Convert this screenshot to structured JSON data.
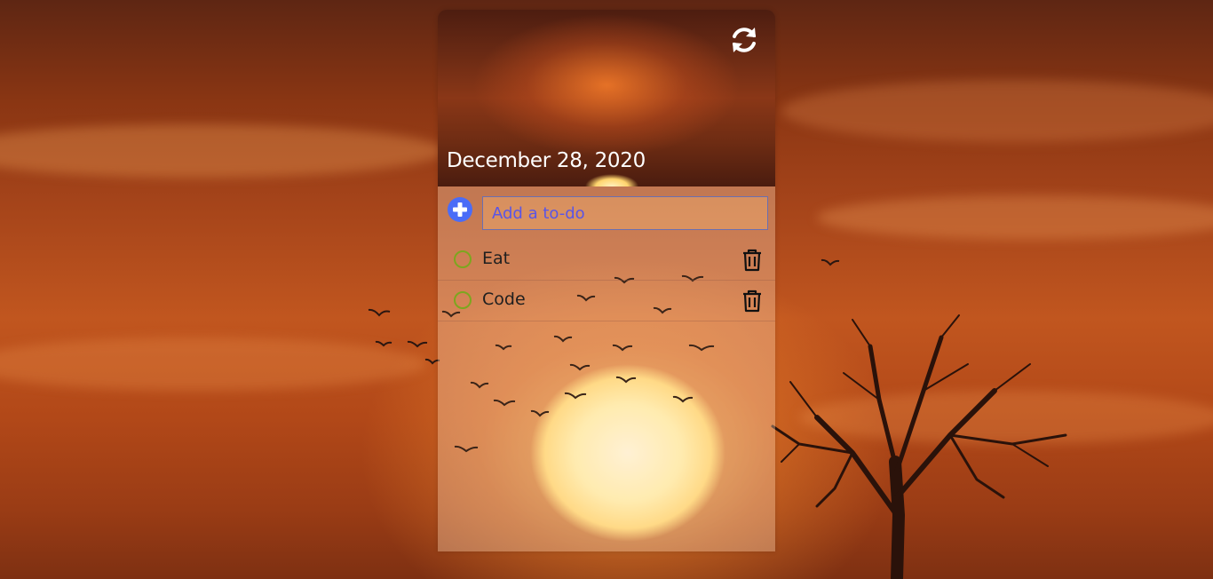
{
  "header": {
    "date": "December 28, 2020",
    "refresh_icon": "refresh-icon"
  },
  "add_todo": {
    "placeholder": "Add a to-do",
    "value": "",
    "add_icon": "plus-circle-icon"
  },
  "todos": [
    {
      "text": "Eat",
      "done": false
    },
    {
      "text": "Code",
      "done": false
    }
  ],
  "colors": {
    "accent_blue": "#4a6cf7",
    "check_green": "#7da61f",
    "placeholder_purple": "#5a55e6"
  }
}
